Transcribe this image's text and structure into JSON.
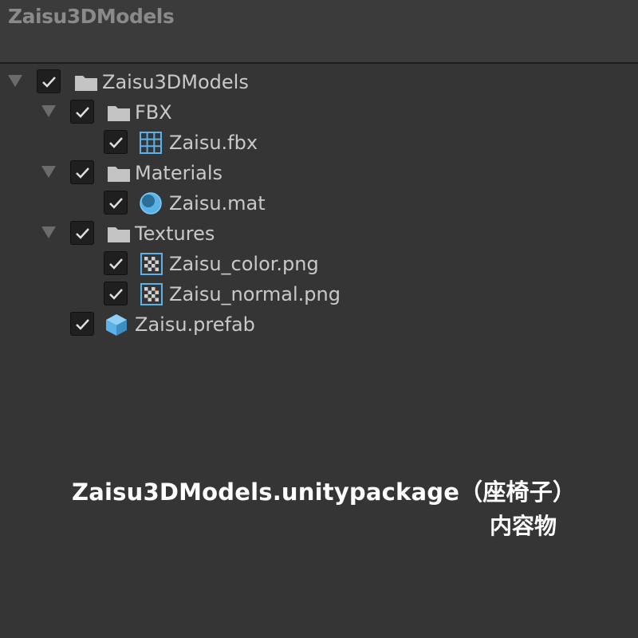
{
  "header": {
    "title": "Zaisu3DModels"
  },
  "tree": {
    "root": {
      "label": "Zaisu3DModels",
      "checked": true,
      "expanded": true,
      "icon": "folder-icon"
    },
    "fbx_folder": {
      "label": "FBX",
      "checked": true,
      "expanded": true,
      "icon": "folder-icon"
    },
    "fbx_file": {
      "label": "Zaisu.fbx",
      "checked": true,
      "icon": "mesh-grid-icon"
    },
    "materials_folder": {
      "label": "Materials",
      "checked": true,
      "expanded": true,
      "icon": "folder-icon"
    },
    "mat_file": {
      "label": "Zaisu.mat",
      "checked": true,
      "icon": "material-sphere-icon"
    },
    "textures_folder": {
      "label": "Textures",
      "checked": true,
      "expanded": true,
      "icon": "folder-icon"
    },
    "color_png": {
      "label": "Zaisu_color.png",
      "checked": true,
      "icon": "texture-checker-icon"
    },
    "normal_png": {
      "label": "Zaisu_normal.png",
      "checked": true,
      "icon": "texture-checker-icon"
    },
    "prefab_file": {
      "label": "Zaisu.prefab",
      "checked": true,
      "icon": "prefab-cube-icon"
    }
  },
  "caption": {
    "line1": "Zaisu3DModels.unitypackage（座椅子）",
    "line2": "内容物"
  },
  "colors": {
    "background": "#353535",
    "header": "#3b3b3b",
    "accent_blue": "#5ab2e8",
    "text": "#c9c9c9",
    "caption": "#ffffff"
  }
}
